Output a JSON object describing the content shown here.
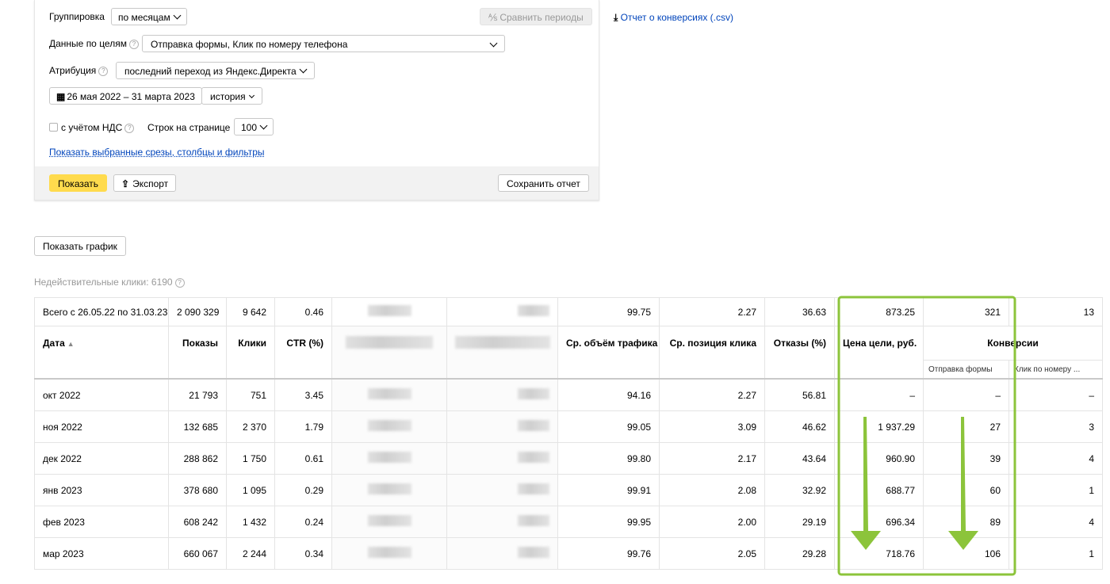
{
  "settings": {
    "grouping_label": "Группировка",
    "grouping_value": "по месяцам",
    "compare_label": "Сравнить периоды",
    "conversions_report_label": "Отчет о конверсиях (.csv)",
    "goals_label": "Данные по целям",
    "goals_value": "Отправка формы, Клик по номеру телефона",
    "attribution_label": "Атрибуция",
    "attribution_value": "последний переход из Яндекс.Директа",
    "date_range": "26 мая 2022 – 31 марта 2023",
    "history_label": "история",
    "vat_label": "с учётом НДС",
    "rows_per_page_label": "Строк на странице",
    "rows_per_page_value": "100",
    "show_selected_link": "Показать выбранные срезы, столбцы и фильтры",
    "show_button": "Показать",
    "export_button": "Экспорт",
    "save_report_button": "Сохранить отчет"
  },
  "show_chart_button": "Показать график",
  "invalid_clicks": "Недействительные клики: 6190",
  "table": {
    "total_row": {
      "label": "Всего с 26.05.22 по 31.03.23",
      "impressions": "2 090 329",
      "clicks": "9 642",
      "ctr": "0.46",
      "traffic": "99.75",
      "click_pos": "2.27",
      "bounces": "36.63",
      "goal_cost": "873.25",
      "conv_form": "321",
      "conv_phone": "13"
    },
    "headers": {
      "date": "Дата",
      "sort_indicator": "▲",
      "impressions": "Показы",
      "clicks": "Клики",
      "ctr": "CTR (%)",
      "traffic": "Ср. объём трафика",
      "click_pos": "Ср. позиция клика",
      "bounces": "Отказы (%)",
      "goal_cost": "Цена цели, руб.",
      "conversions": "Конверсии",
      "conv_form": "Отправка формы",
      "conv_phone": "Клик по номеру ..."
    },
    "rows": [
      {
        "date": "окт 2022",
        "impressions": "21 793",
        "clicks": "751",
        "ctr": "3.45",
        "traffic": "94.16",
        "click_pos": "2.27",
        "bounces": "56.81",
        "goal_cost": "–",
        "conv_form": "–",
        "conv_phone": "–"
      },
      {
        "date": "ноя 2022",
        "impressions": "132 685",
        "clicks": "2 370",
        "ctr": "1.79",
        "traffic": "99.05",
        "click_pos": "3.09",
        "bounces": "46.62",
        "goal_cost": "1 937.29",
        "conv_form": "27",
        "conv_phone": "3"
      },
      {
        "date": "дек 2022",
        "impressions": "288 862",
        "clicks": "1 750",
        "ctr": "0.61",
        "traffic": "99.80",
        "click_pos": "2.17",
        "bounces": "43.64",
        "goal_cost": "960.90",
        "conv_form": "39",
        "conv_phone": "4"
      },
      {
        "date": "янв 2023",
        "impressions": "378 680",
        "clicks": "1 095",
        "ctr": "0.29",
        "traffic": "99.91",
        "click_pos": "2.08",
        "bounces": "32.92",
        "goal_cost": "688.77",
        "conv_form": "60",
        "conv_phone": "1"
      },
      {
        "date": "фев 2023",
        "impressions": "608 242",
        "clicks": "1 432",
        "ctr": "0.24",
        "traffic": "99.95",
        "click_pos": "2.00",
        "bounces": "29.19",
        "goal_cost": "696.34",
        "conv_form": "89",
        "conv_phone": "4"
      },
      {
        "date": "мар 2023",
        "impressions": "660 067",
        "clicks": "2 244",
        "ctr": "0.34",
        "traffic": "99.76",
        "click_pos": "2.05",
        "bounces": "29.28",
        "goal_cost": "718.76",
        "conv_form": "106",
        "conv_phone": "1"
      }
    ]
  },
  "colors": {
    "highlight": "#8cc43b",
    "accent_button": "#ffdb4d",
    "link": "#0044bb"
  }
}
